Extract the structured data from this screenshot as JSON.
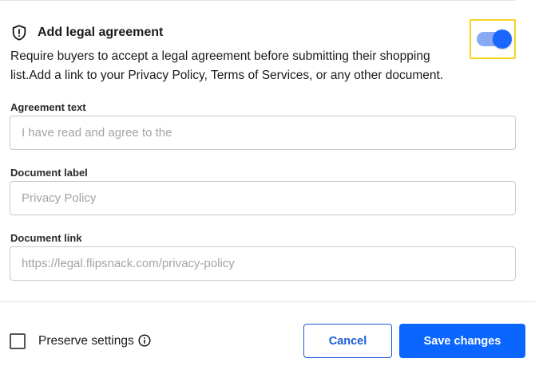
{
  "section": {
    "title": "Add legal agreement",
    "description": "Require buyers to accept a legal agreement before submitting their shopping list.Add a link to your Privacy Policy, Terms of Services, or any other document.",
    "toggle_on": true
  },
  "fields": {
    "agreement_text": {
      "label": "Agreement text",
      "placeholder": "I have read and agree to the",
      "value": ""
    },
    "document_label": {
      "label": "Document label",
      "placeholder": "Privacy Policy",
      "value": ""
    },
    "document_link": {
      "label": "Document link",
      "placeholder": "https://legal.flipsnack.com/privacy-policy",
      "value": ""
    }
  },
  "footer": {
    "preserve_label": "Preserve settings",
    "preserve_checked": false,
    "cancel_label": "Cancel",
    "save_label": "Save changes"
  },
  "colors": {
    "accent": "#0b66ff",
    "toggle_track": "#88aaf5",
    "highlight": "#f5d327"
  },
  "icons": {
    "section": "shield-alert-icon",
    "info": "info-icon"
  }
}
